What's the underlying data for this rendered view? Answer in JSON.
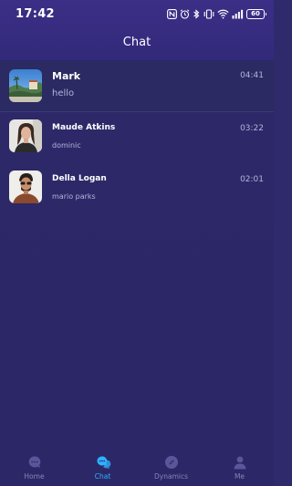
{
  "status_bar": {
    "time": "17:42",
    "battery": "60",
    "icons": [
      "nfc-icon",
      "alarm-icon",
      "bluetooth-icon",
      "vibrate-icon",
      "wifi-icon",
      "signal-icon",
      "battery-icon"
    ]
  },
  "header": {
    "title": "Chat"
  },
  "chats": [
    {
      "name": "Mark",
      "preview": "hello",
      "time": "04:41",
      "avatar": "landscape-photo"
    },
    {
      "name": "Maude Atkins",
      "preview": "dominic",
      "time": "03:22",
      "avatar": "woman-portrait-photo"
    },
    {
      "name": "Della Logan",
      "preview": "mario parks",
      "time": "02:01",
      "avatar": "man-portrait-photo"
    }
  ],
  "tab_bar": {
    "tabs": [
      {
        "label": "Home",
        "icon": "home-chat-icon",
        "active": false
      },
      {
        "label": "Chat",
        "icon": "chat-bubbles-icon",
        "active": true
      },
      {
        "label": "Dynamics",
        "icon": "compass-icon",
        "active": false
      },
      {
        "label": "Me",
        "icon": "person-icon",
        "active": false
      }
    ]
  },
  "colors": {
    "background": "#2c2867",
    "header": "#3a2f86",
    "active_tab": "#2fb2ff",
    "inactive_tab": "#8683b9",
    "preview_text": "#b6b4dc"
  }
}
